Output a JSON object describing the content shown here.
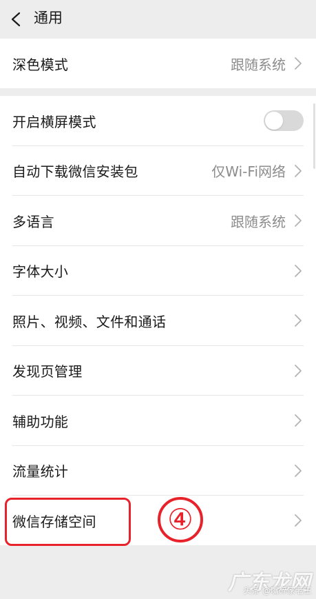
{
  "header": {
    "title": "通用",
    "back_icon": "chevron-left-icon"
  },
  "group1": {
    "items": [
      {
        "label": "深色模式",
        "value": "跟随系统"
      }
    ]
  },
  "group2": {
    "items": [
      {
        "label": "开启横屏模式",
        "toggle": false
      },
      {
        "label": "自动下载微信安装包",
        "value": "仅Wi-Fi网络"
      },
      {
        "label": "多语言",
        "value": "跟随系统"
      },
      {
        "label": "字体大小"
      },
      {
        "label": "照片、视频、文件和通话"
      },
      {
        "label": "发现页管理"
      },
      {
        "label": "辅助功能"
      },
      {
        "label": "流量统计"
      },
      {
        "label": "微信存储空间"
      }
    ]
  },
  "annotation": {
    "step_number": "④",
    "color": "#e8222a"
  },
  "watermark": {
    "logo_text": "广东龙网",
    "caption": "头条 @嘴碎家老王"
  },
  "colors": {
    "background": "#ededed",
    "card": "#ffffff",
    "secondary_text": "#8c8c8c",
    "toggle_off": "#d9d9d9"
  }
}
